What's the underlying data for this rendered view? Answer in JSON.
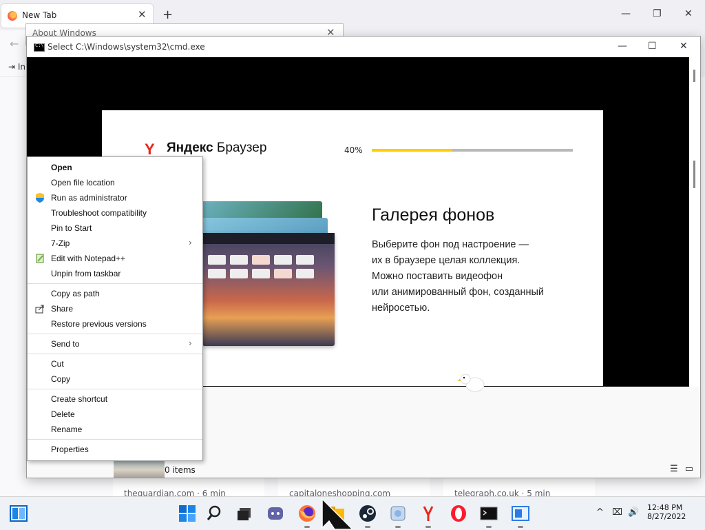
{
  "browser": {
    "tab_title": "New Tab",
    "close": "✕",
    "new_tab": "+",
    "back": "←",
    "import_label": "In",
    "window_controls": [
      "—",
      "❐",
      "✕"
    ],
    "news": [
      "theguardian.com · 6 min",
      "capitaloneshopping.com",
      "telegraph.co.uk · 5 min"
    ]
  },
  "about_dialog": {
    "title": "About Windows",
    "close": "✕"
  },
  "cmd": {
    "title": "Select C:\\Windows\\system32\\cmd.exe",
    "icon_text": "C:\\",
    "window_controls": [
      "—",
      "☐",
      "✕"
    ],
    "status": "0 items"
  },
  "yandex": {
    "logo_mark": "Y",
    "brand_bold": "Яндекс",
    "brand_rest": "Браузер",
    "progress_label": "40%",
    "progress": 0.4,
    "heading": "Галерея фонов",
    "description": [
      "Выберите фон под настроение —",
      "их в браузере целая коллекция.",
      "Можно поставить видеофон",
      "или анимированный фон, созданный",
      "нейросетью."
    ],
    "colors": {
      "accent": "#ffcc00",
      "brand": "#e8271b"
    }
  },
  "context_menu": {
    "items": [
      {
        "label": "Open",
        "bold": true
      },
      {
        "label": "Open file location"
      },
      {
        "label": "Run as administrator",
        "icon": "shield-icon"
      },
      {
        "label": "Troubleshoot compatibility"
      },
      {
        "label": "Pin to Start"
      },
      {
        "label": "7-Zip",
        "submenu": true
      },
      {
        "label": "Edit with Notepad++",
        "icon": "notepad-icon"
      },
      {
        "label": "Unpin from taskbar"
      },
      {
        "label": "Copy as path"
      },
      {
        "label": "Share",
        "icon": "share-icon"
      },
      {
        "label": "Restore previous versions"
      },
      {
        "label": "Send to",
        "submenu": true
      },
      {
        "label": "Cut"
      },
      {
        "label": "Copy"
      },
      {
        "label": "Create shortcut"
      },
      {
        "label": "Delete"
      },
      {
        "label": "Rename"
      },
      {
        "label": "Properties"
      }
    ],
    "submenu_arrow": "›"
  },
  "taskbar": {
    "apps": [
      "start-icon",
      "search-icon",
      "task-view-icon",
      "chat-icon",
      "firefox-icon",
      "file-explorer-icon",
      "steam-icon",
      "system-app-icon",
      "yandex-icon",
      "opera-icon",
      "cmd-icon",
      "app-window-icon"
    ],
    "tray_symbols": [
      "^",
      "⌧",
      "🔊"
    ],
    "time": "12:48 PM",
    "date": "8/27/2022"
  }
}
